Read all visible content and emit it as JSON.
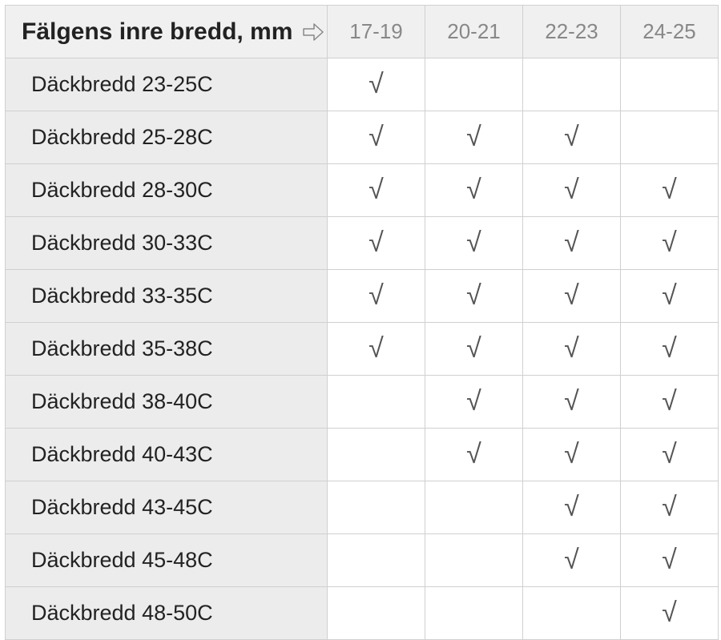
{
  "table": {
    "cornerLabel": "Fälgens inre bredd, mm",
    "columns": [
      "17-19",
      "20-21",
      "22-23",
      "24-25"
    ],
    "checkmark": "√",
    "rows": [
      {
        "label": "Däckbredd 23-25C",
        "cells": [
          true,
          false,
          false,
          false
        ]
      },
      {
        "label": "Däckbredd 25-28C",
        "cells": [
          true,
          true,
          true,
          false
        ]
      },
      {
        "label": "Däckbredd 28-30C",
        "cells": [
          true,
          true,
          true,
          true
        ]
      },
      {
        "label": "Däckbredd 30-33C",
        "cells": [
          true,
          true,
          true,
          true
        ]
      },
      {
        "label": "Däckbredd 33-35C",
        "cells": [
          true,
          true,
          true,
          true
        ]
      },
      {
        "label": "Däckbredd 35-38C",
        "cells": [
          true,
          true,
          true,
          true
        ]
      },
      {
        "label": "Däckbredd 38-40C",
        "cells": [
          false,
          true,
          true,
          true
        ]
      },
      {
        "label": "Däckbredd 40-43C",
        "cells": [
          false,
          true,
          true,
          true
        ]
      },
      {
        "label": "Däckbredd 43-45C",
        "cells": [
          false,
          false,
          true,
          true
        ]
      },
      {
        "label": "Däckbredd 45-48C",
        "cells": [
          false,
          false,
          true,
          true
        ]
      },
      {
        "label": "Däckbredd 48-50C",
        "cells": [
          false,
          false,
          false,
          true
        ]
      }
    ]
  }
}
